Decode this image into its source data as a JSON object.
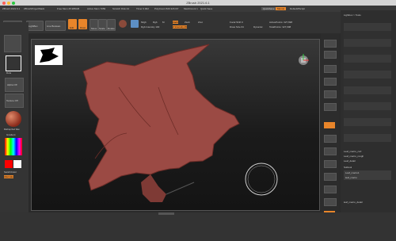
{
  "window": {
    "title": "ZBrush 2021.6.1"
  },
  "infobar": {
    "items": [
      "ZBrush 2021.6.1",
      "ZBrushProjectMack",
      "Free Mem 25.986GB",
      "Active Mem 7059",
      "Scratch Disk 44",
      "Timer 0.002",
      "PolyCount 820.326 KP",
      "MeshCount 1",
      "Quick Save"
    ],
    "quicksave_label": "QuickSave",
    "menu_label": "Menus",
    "script_label": "DefaultZScript"
  },
  "menus": [
    "Alpha",
    "Brush",
    "Color",
    "Document",
    "Draw",
    "Dynamics",
    "Edit",
    "File",
    "Layer",
    "Light",
    "Macro",
    "Marker",
    "Material",
    "Movie",
    "Picker",
    "Preferences",
    "Render",
    "Stencil",
    "Stroke",
    "Texture",
    "Tool",
    "Transform",
    "Zplugin",
    "Zscript",
    "Help"
  ],
  "shelf": {
    "home_label": "Home Page",
    "lightbox_label": "LightBox",
    "liveboolean_label": "Live Boolean",
    "tool_labels": [
      "Edit",
      "Draw",
      "Move",
      "Scale",
      "Rotate"
    ],
    "mrgb": "Mrgb",
    "rgb": "Rgb",
    "m": "M",
    "zadd": "Zadd",
    "zsub": "Zsub",
    "zcut": "Zcut",
    "rgb_intensity": "Rgb Intensity 100",
    "z_intensity": "Z Intensity 25",
    "focal_shift": "Focal Shift 0",
    "draw_size": "Draw Size 64",
    "dynamic": "Dynamic",
    "active_points": "ActivePoints: 327,698",
    "total_points": "TotalPoints: 327,698"
  },
  "left": {
    "gradient_label": "Gradient",
    "switch_color_label": "SwitchColor",
    "alternate_label": "Alternate",
    "dots_label": "Dots",
    "alpha_off": "Alpha Off",
    "texture_off": "Texture Off",
    "material_label": "MatCap Red Wax"
  },
  "right_panel": {
    "subtools": [
      "Leaf_macro_curl",
      "Leaf_macro_rough",
      "Leaf_detail"
    ],
    "tool_label": "Lightbox > Tools",
    "subtool_label": "Subtool",
    "list_items": [
      "Leaf_macro1",
      "leaf_macro",
      "leaf_macro_detail"
    ],
    "new_folder": "New Folder"
  },
  "colors": {
    "accent": "#e8852a",
    "leaf": "#9b4a44",
    "primary_swatch": "#ff0000"
  }
}
